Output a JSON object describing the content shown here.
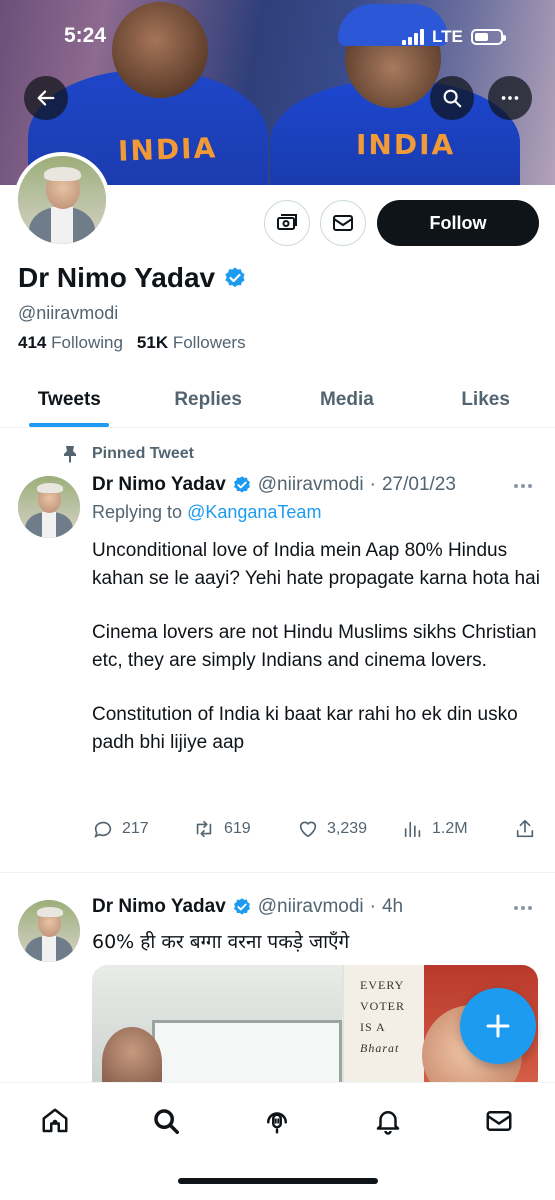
{
  "status_bar": {
    "time": "5:24",
    "network": "LTE"
  },
  "banner": {
    "jersey_text_1": "INDIA",
    "jersey_text_2": "INDIA"
  },
  "profile": {
    "name": "Dr Nimo Yadav",
    "handle": "@niiravmodi",
    "following_count": "414",
    "following_label": "Following",
    "followers_count": "51K",
    "followers_label": "Followers",
    "follow_label": "Follow"
  },
  "tabs": [
    {
      "label": "Tweets",
      "active": true
    },
    {
      "label": "Replies",
      "active": false
    },
    {
      "label": "Media",
      "active": false
    },
    {
      "label": "Likes",
      "active": false
    }
  ],
  "pinned_label": "Pinned Tweet",
  "tweets": [
    {
      "name": "Dr Nimo Yadav",
      "handle": "@niiravmodi",
      "time": "27/01/23",
      "replying_prefix": "Replying to",
      "replying_to": "@KanganaTeam",
      "paragraphs": [
        "Unconditional love of India mein Aap 80% Hindus kahan se le aayi? Yehi hate propagate karna hota hai",
        "Cinema lovers are not Hindu Muslims sikhs Christian etc, they are simply Indians and cinema lovers.",
        "Constitution of India ki baat kar rahi ho ek din usko padh bhi lijiye aap"
      ],
      "replies": "217",
      "retweets": "619",
      "likes": "3,239",
      "views": "1.2M"
    },
    {
      "name": "Dr Nimo Yadav",
      "handle": "@niiravmodi",
      "time": "4h",
      "text": "60% ही कर बग्गा वरना पकड़े जाएँगे",
      "media_poster_lines": [
        "EVERY",
        "VOTER",
        "IS A",
        "Bharat"
      ]
    }
  ],
  "colors": {
    "accent": "#1d9bf0",
    "text": "#0f1419",
    "muted": "#536471"
  }
}
